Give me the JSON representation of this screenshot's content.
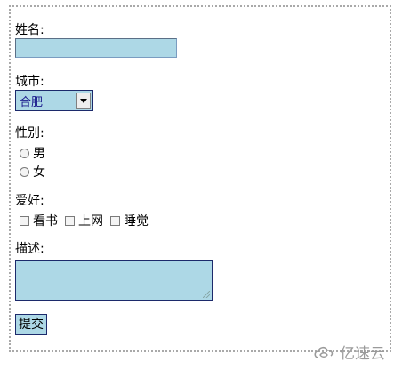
{
  "form": {
    "name_label": "姓名:",
    "name_value": "",
    "city_label": "城市:",
    "city_selected": "合肥",
    "gender_label": "性别:",
    "gender_options": [
      "男",
      "女"
    ],
    "hobby_label": "爱好:",
    "hobby_options": [
      "看书",
      "上网",
      "睡觉"
    ],
    "desc_label": "描述:",
    "submit_label": "提交"
  },
  "watermark": {
    "text": "亿速云"
  },
  "colors": {
    "field_bg": "#add8e6",
    "field_border": "#1c2a6b"
  }
}
